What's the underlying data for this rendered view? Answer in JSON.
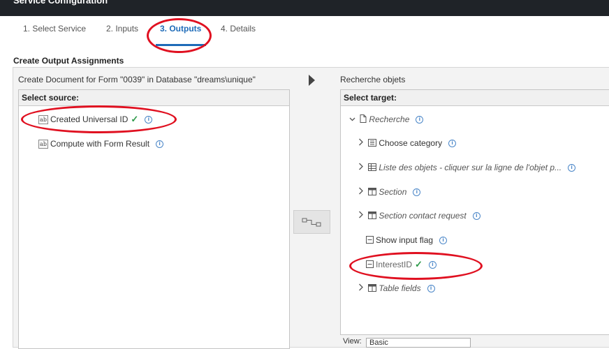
{
  "window": {
    "title": "Service Configuration"
  },
  "tabs": [
    {
      "label": "1. Select Service"
    },
    {
      "label": "2. Inputs"
    },
    {
      "label": "3. Outputs"
    },
    {
      "label": "4. Details"
    }
  ],
  "section": {
    "title": "Create Output Assignments"
  },
  "source": {
    "caption": "Create Document for Form \"0039\" in Database \"dreams\\unique\"",
    "header": "Select source:",
    "items": [
      {
        "label": "Created Universal ID",
        "mapped": "✓"
      },
      {
        "label": "Compute with Form Result"
      }
    ]
  },
  "target": {
    "caption": "Recherche objets",
    "header": "Select target:",
    "root": {
      "label": "Recherche"
    },
    "items": [
      {
        "label": "Choose category"
      },
      {
        "label": "Liste des objets - cliquer sur la ligne de l'objet p..."
      },
      {
        "label": "Section"
      },
      {
        "label": "Section contact request"
      },
      {
        "label": "Show input flag"
      },
      {
        "label": "InterestID",
        "mapped": "✓"
      },
      {
        "label": "Table fields"
      }
    ],
    "view_label": "View:",
    "view_value": "Basic"
  },
  "icons": {
    "info": "i",
    "ab": "ab",
    "chevron_right": "›",
    "chevron_down": "⌄"
  },
  "colors": {
    "accent": "#1e6bb8",
    "check": "#2e9a4a",
    "annotation": "#e01020",
    "titlebar": "#1f2328"
  }
}
